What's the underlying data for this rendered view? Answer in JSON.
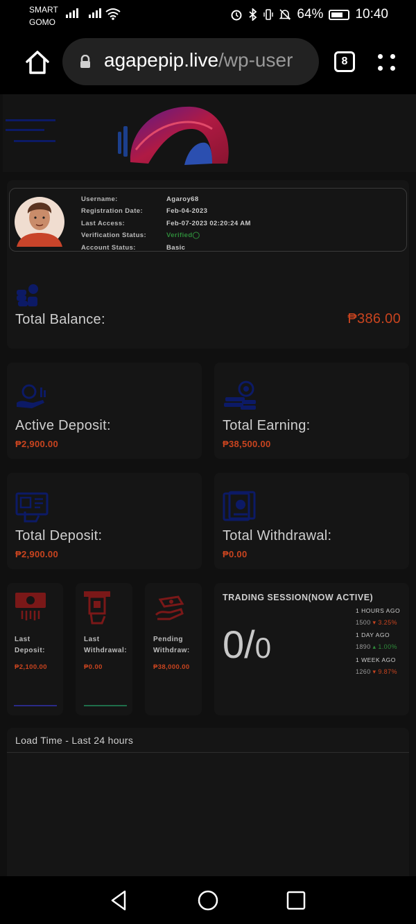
{
  "status_bar": {
    "carrier_line1": "SMART",
    "carrier_line2": "GOMO",
    "battery": "64%",
    "time": "10:40",
    "icons": [
      "signal-icon",
      "signal-icon",
      "wifi-icon",
      "alarm-icon",
      "bluetooth-icon",
      "vibrate-icon",
      "mute-icon",
      "battery-icon"
    ]
  },
  "browser": {
    "url_host": "agapepip.live",
    "url_path": "/wp-user",
    "tab_count": "8",
    "icons": [
      "home-icon",
      "lock-icon",
      "tabs-icon",
      "menu-dots-icon"
    ]
  },
  "profile": {
    "labels": {
      "username": "Username:",
      "registration_date": "Registration Date:",
      "last_access": "Last Access:",
      "verification_status": "Verification Status:",
      "account_status": "Account Status:"
    },
    "values": {
      "username": "Agaroy68",
      "registration_date": "Feb-04-2023",
      "last_access": "Feb-07-2023 02:20:24 AM",
      "verification_status": "Verified",
      "account_status": "Basic"
    }
  },
  "balance": {
    "label": "Total Balance:",
    "value": "₱386.00"
  },
  "stats": {
    "active_deposit": {
      "label": "Active Deposit:",
      "value": "₱2,900.00"
    },
    "total_earning": {
      "label": "Total Earning:",
      "value": "₱38,500.00"
    },
    "total_deposit": {
      "label": "Total Deposit:",
      "value": "₱2,900.00"
    },
    "total_withdrawal": {
      "label": "Total Withdrawal:",
      "value": "₱0.00"
    }
  },
  "mini": {
    "last_deposit": {
      "line1": "Last",
      "line2": "Deposit:",
      "value": "₱2,100.00"
    },
    "last_withdrawal": {
      "line1": "Last",
      "line2": "Withdrawal:",
      "value": "₱0.00"
    },
    "pending_withdraw": {
      "line1": "Pending",
      "line2": "Withdraw:",
      "value": "₱38,000.00"
    }
  },
  "trading": {
    "title": "TRADING SESSION(NOW ACTIVE)",
    "score_num": "0/",
    "score_den": "0",
    "rows": [
      {
        "head": "1 HOURS AGO",
        "value": "1500",
        "change": "3.25%",
        "direction": "down"
      },
      {
        "head": "1 DAY AGO",
        "value": "1890",
        "change": "1.00%",
        "direction": "up"
      },
      {
        "head": "1 WEEK AGO",
        "value": "1260",
        "change": "9.87%",
        "direction": "down"
      }
    ]
  },
  "load_time": {
    "title": "Load Time - Last 24 hours"
  },
  "colors": {
    "accent_orange": "#c9441f",
    "verified_green": "#2e8b3a",
    "card_bg": "#151515",
    "page_bg": "#101010",
    "icon_navy": "#0c1a66",
    "icon_red": "#7a1818"
  }
}
